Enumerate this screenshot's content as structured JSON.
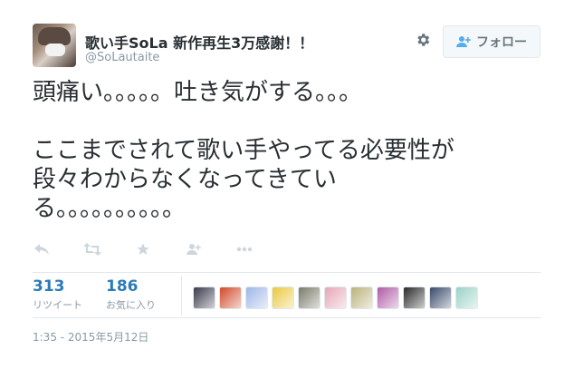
{
  "user": {
    "name": "歌い手SoLa 新作再生3万感謝！！",
    "handle": "@SoLautaite"
  },
  "follow_button": {
    "label": "フォロー"
  },
  "tweet": {
    "text": "頭痛い。。。。。吐き気がする。。。\n\nここまでされて歌い手やってる必要性が\n段々わからなくなってきてい\nる。。。。。。。。。。"
  },
  "stats": {
    "retweets": {
      "count": "313",
      "label": "リツイート"
    },
    "favorites": {
      "count": "186",
      "label": "お気に入り"
    }
  },
  "favoriter_avatars": [
    {
      "color": "#3a3a4a"
    },
    {
      "color": "#d04a2a"
    },
    {
      "color": "#9fb6e6"
    },
    {
      "color": "#e9c840"
    },
    {
      "color": "#7a7a6a"
    },
    {
      "color": "#e6a6b6"
    },
    {
      "color": "#b9b27a"
    },
    {
      "color": "#b05aa6"
    },
    {
      "color": "#2a2a2a"
    },
    {
      "color": "#3a4a6a"
    },
    {
      "color": "#9ad2c6"
    }
  ],
  "timestamp": "1:35 - 2015年5月12日",
  "icons": {
    "reply": "reply-icon",
    "retweet": "retweet-icon",
    "favorite": "star-icon",
    "follow": "follow-icon",
    "more": "more-icon",
    "gear": "gear-icon"
  },
  "colors": {
    "link_blue": "#2b7bb9",
    "muted": "#8899a6",
    "action_gray": "#ccd6dd",
    "text": "#292f33",
    "follow_accent": "#55acee"
  }
}
